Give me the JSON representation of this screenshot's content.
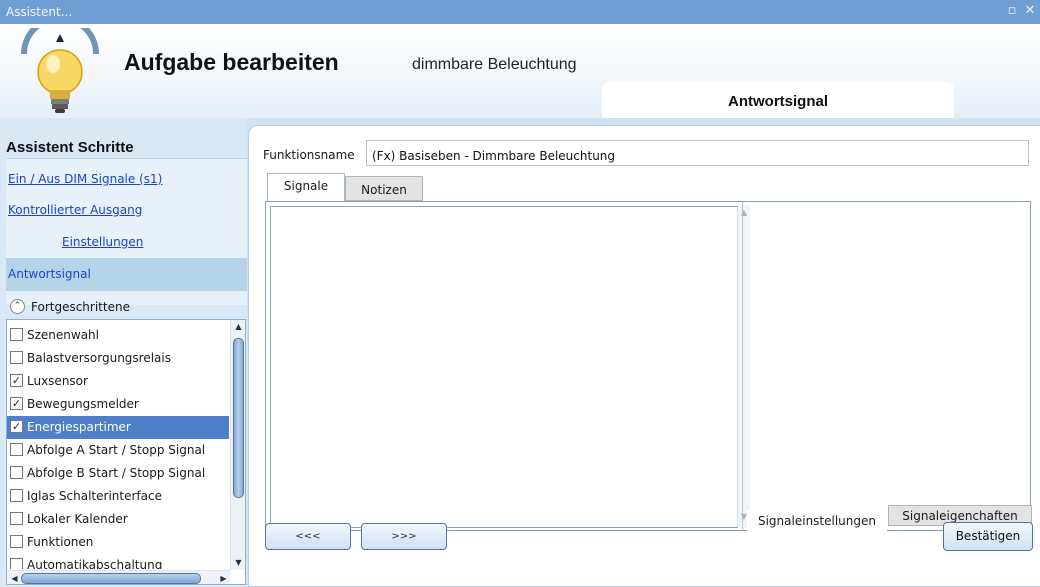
{
  "window": {
    "title": "Assistent..."
  },
  "header": {
    "title": "Aufgabe bearbeiten",
    "subtitle": "dimmbare Beleuchtung",
    "current_step": "Antwortsignal"
  },
  "sidebar": {
    "heading": "Assistent Schritte",
    "steps": [
      {
        "label": "Ein / Aus DIM Signale (s1)"
      },
      {
        "label": "Kontrollierter Ausgang"
      },
      {
        "label": "Einstellungen"
      },
      {
        "label": "Antwortsignal",
        "active": true
      }
    ],
    "advanced_label": "Fortgeschrittene",
    "advanced_items": [
      {
        "label": "Szenenwahl",
        "checked": false
      },
      {
        "label": "Balastversorgungsrelais",
        "checked": false
      },
      {
        "label": "Luxsensor",
        "checked": true
      },
      {
        "label": "Bewegungsmelder",
        "checked": true
      },
      {
        "label": "Energiespartimer",
        "checked": true,
        "selected": true
      },
      {
        "label": "Abfolge A Start / Stopp Signal",
        "checked": false
      },
      {
        "label": "Abfolge B Start / Stopp Signal",
        "checked": false
      },
      {
        "label": "Iglas Schalterinterface",
        "checked": false
      },
      {
        "label": "Lokaler Kalender",
        "checked": false
      },
      {
        "label": "Funktionen",
        "checked": false
      },
      {
        "label": "Automatikabschaltung",
        "checked": false
      }
    ]
  },
  "main": {
    "function_name_label": "Funktionsname",
    "function_name_value": "(Fx) Basiseben - Dimmbare Beleuchtung",
    "tabs": [
      {
        "label": "Signale",
        "active": true
      },
      {
        "label": "Notizen"
      }
    ],
    "property_tabs": [
      {
        "label": "Signaleinstellungen",
        "active": true
      },
      {
        "label": "Signaleigenchaften"
      }
    ]
  },
  "footer": {
    "prev_label": "<<<",
    "next_label": ">>>",
    "confirm_label": "Bestätigen"
  },
  "colors": {
    "titlebar": "#6e9ed3",
    "selection": "#4f7fc8",
    "link": "#1a44c8",
    "active_step": "#b6d4e8"
  },
  "icons": {
    "logo": "lightbulb-icon",
    "maximize": "maximize-icon",
    "close": "close-icon",
    "collapse": "chevron-up-icon",
    "checked": "check-icon"
  }
}
